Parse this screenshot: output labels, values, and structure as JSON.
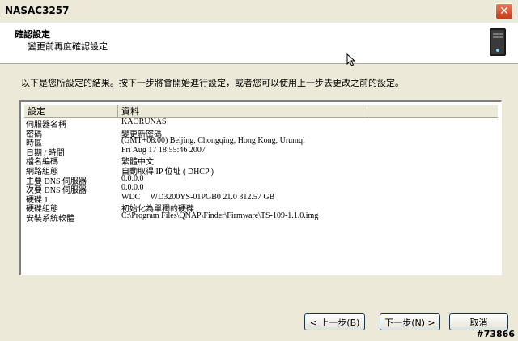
{
  "window": {
    "title": "NASAC3257"
  },
  "header": {
    "title": "確認設定",
    "subtitle": "變更前再度確認設定"
  },
  "instruction": "以下是您所設定的結果。按下一步將會開始進行設定，或者您可以使用上一步去更改之前的設定。",
  "table": {
    "columns": [
      "設定",
      "資料",
      ""
    ],
    "rows": [
      {
        "key": "伺服器名稱",
        "value": "KAORUNAS"
      },
      {
        "key": "密碼",
        "value": "變更新密碼"
      },
      {
        "key": "時區",
        "value": "(GMT+08:00) Beijing, Chongqing, Hong Kong, Urumqi"
      },
      {
        "key": "日期 / 時間",
        "value": "Fri Aug 17 18:55:46 2007"
      },
      {
        "key": "檔名編碼",
        "value": "繁體中文"
      },
      {
        "key": "網路組態",
        "value": "自動取得 IP 位址 ( DHCP )"
      },
      {
        "key": "主要 DNS 伺服器",
        "value": "0.0.0.0"
      },
      {
        "key": "次要 DNS 伺服器",
        "value": "0.0.0.0"
      },
      {
        "key": "硬碟 1",
        "value": "WDC     WD3200YS-01PGB0 21.0 312.57 GB"
      },
      {
        "key": "硬碟組態",
        "value": "初始化為單獨的硬碟"
      },
      {
        "key": "安裝系統軟體",
        "value": "C:\\Program Files\\QNAP\\Finder\\Firmware\\TS-109-1.1.0.img"
      }
    ]
  },
  "buttons": {
    "back": "< 上一步(B)",
    "next": "下一步(N) >",
    "cancel": "取消"
  },
  "watermark": "#73866",
  "icons": {
    "close": "close-icon",
    "header": "nas-device-icon",
    "cursor": "mouse-pointer-icon"
  },
  "colors": {
    "dialog_bg": "#ece9d8",
    "close_button": "#c63d19",
    "button_border": "#003c74"
  }
}
